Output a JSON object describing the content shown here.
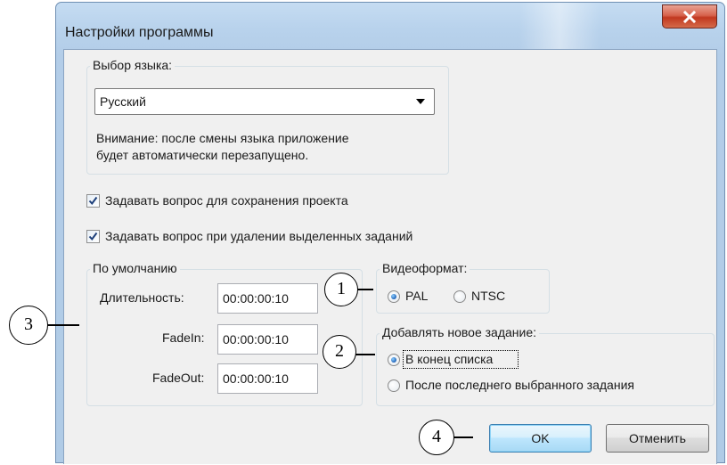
{
  "window": {
    "title": "Настройки программы",
    "close_icon": "close-x-icon"
  },
  "language": {
    "legend": "Выбор языка:",
    "selected": "Русский",
    "note_line1": "Внимание: после смены языка приложение",
    "note_line2": "будет автоматически перезапущено."
  },
  "options": {
    "ask_save_project": {
      "label": "Задавать вопрос для сохранения проекта",
      "checked": true
    },
    "ask_delete_tasks": {
      "label": "Задавать вопрос при удалении выделенных заданий",
      "checked": true
    }
  },
  "defaults": {
    "legend": "По умолчанию",
    "duration_label": "Длительность:",
    "duration_value": "00:00:00:10",
    "fadein_label": "FadeIn:",
    "fadein_value": "00:00:00:10",
    "fadeout_label": "FadeOut:",
    "fadeout_value": "00:00:00:10"
  },
  "video_format": {
    "legend": "Видеоформат:",
    "options": [
      "PAL",
      "NTSC"
    ],
    "selected": "PAL"
  },
  "new_task": {
    "legend": "Добавлять новое задание:",
    "options": [
      "В конец списка",
      "После последнего выбранного задания"
    ],
    "selected": "В конец списка"
  },
  "buttons": {
    "ok": "OK",
    "cancel": "Отменить"
  },
  "callouts": [
    "1",
    "2",
    "3",
    "4"
  ],
  "colors": {
    "titlebar": "#b8d2ec",
    "client_bg": "#f0f0f0",
    "close_button": "#c1381f",
    "default_button_border": "#3c7fb1"
  }
}
